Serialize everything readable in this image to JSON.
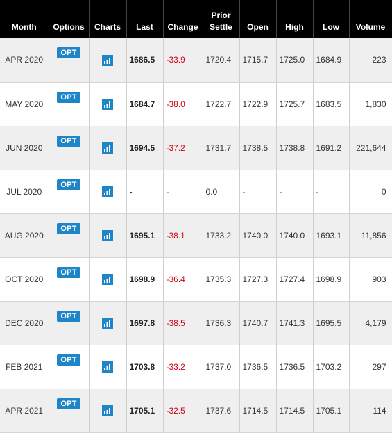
{
  "columns": {
    "month": "Month",
    "options": "Options",
    "charts": "Charts",
    "last": "Last",
    "change": "Change",
    "prior_line1": "Prior",
    "prior_line2": "Settle",
    "open": "Open",
    "high": "High",
    "low": "Low",
    "volume": "Volume"
  },
  "opt_label": "OPT",
  "colors": {
    "header_bg": "#000000",
    "accent": "#1f85c9",
    "negative": "#d0021b",
    "row_alt": "#efefef"
  },
  "rows": [
    {
      "month": "APR 2020",
      "last": "1686.5",
      "change": "-33.9",
      "prior": "1720.4",
      "open": "1715.7",
      "high": "1725.0",
      "low": "1684.9",
      "volume": "223"
    },
    {
      "month": "MAY 2020",
      "last": "1684.7",
      "change": "-38.0",
      "prior": "1722.7",
      "open": "1722.9",
      "high": "1725.7",
      "low": "1683.5",
      "volume": "1,830"
    },
    {
      "month": "JUN 2020",
      "last": "1694.5",
      "change": "-37.2",
      "prior": "1731.7",
      "open": "1738.5",
      "high": "1738.8",
      "low": "1691.2",
      "volume": "221,644"
    },
    {
      "month": "JUL 2020",
      "last": "-",
      "change": "-",
      "prior": "0.0",
      "open": "-",
      "high": "-",
      "low": "-",
      "volume": "0"
    },
    {
      "month": "AUG 2020",
      "last": "1695.1",
      "change": "-38.1",
      "prior": "1733.2",
      "open": "1740.0",
      "high": "1740.0",
      "low": "1693.1",
      "volume": "11,856"
    },
    {
      "month": "OCT 2020",
      "last": "1698.9",
      "change": "-36.4",
      "prior": "1735.3",
      "open": "1727.3",
      "high": "1727.4",
      "low": "1698.9",
      "volume": "903"
    },
    {
      "month": "DEC 2020",
      "last": "1697.8",
      "change": "-38.5",
      "prior": "1736.3",
      "open": "1740.7",
      "high": "1741.3",
      "low": "1695.5",
      "volume": "4,179"
    },
    {
      "month": "FEB 2021",
      "last": "1703.8",
      "change": "-33.2",
      "prior": "1737.0",
      "open": "1736.5",
      "high": "1736.5",
      "low": "1703.2",
      "volume": "297"
    },
    {
      "month": "APR 2021",
      "last": "1705.1",
      "change": "-32.5",
      "prior": "1737.6",
      "open": "1714.5",
      "high": "1714.5",
      "low": "1705.1",
      "volume": "114"
    }
  ]
}
